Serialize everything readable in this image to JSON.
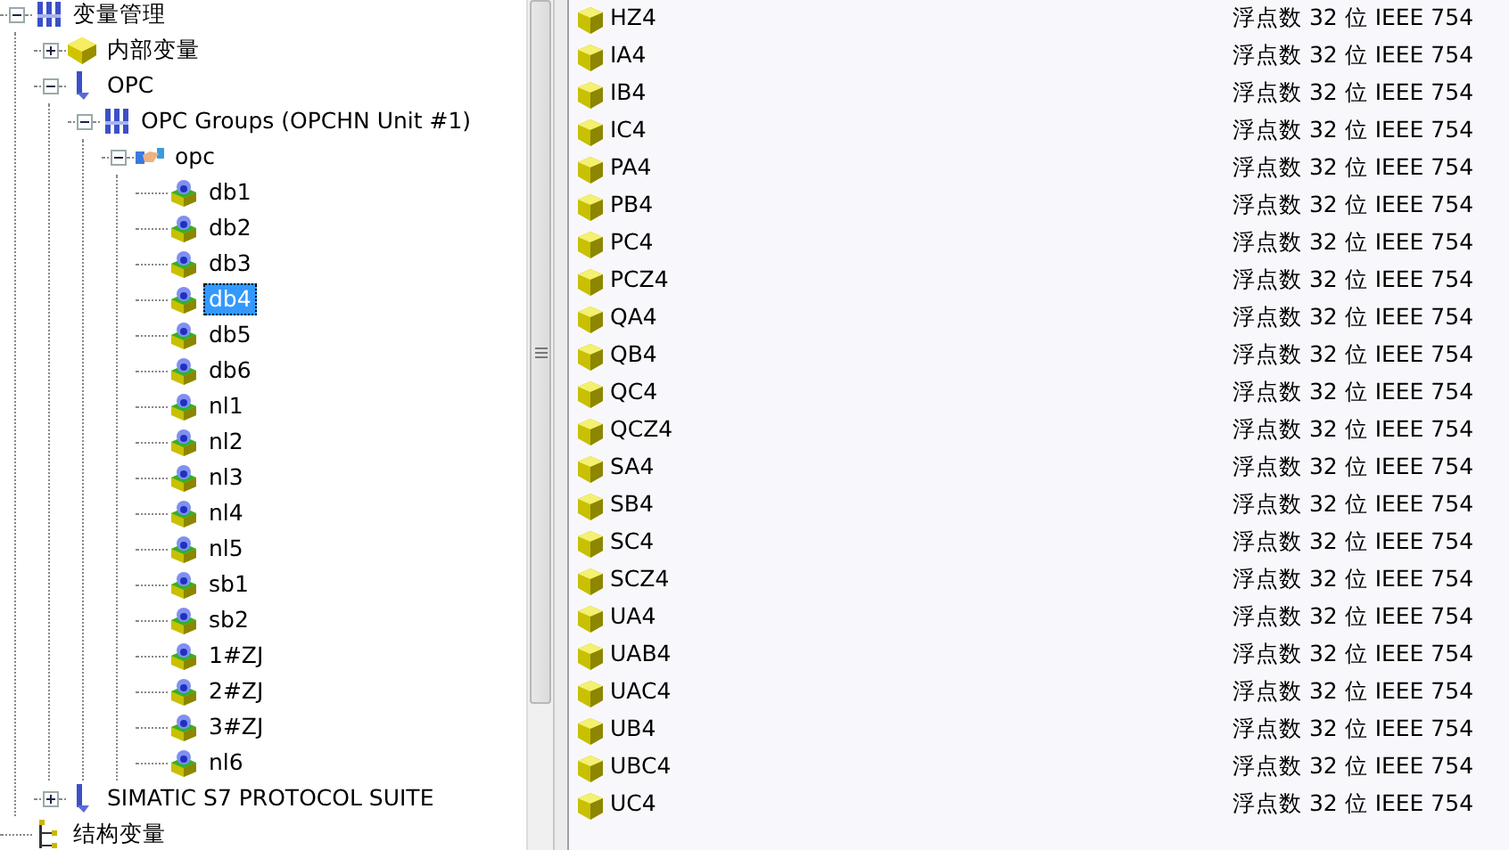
{
  "tree": [
    {
      "label": "变量管理",
      "kind": "group",
      "expanded": true,
      "selected": false,
      "children": [
        {
          "label": "内部变量",
          "kind": "internal",
          "expanded": false,
          "selected": false
        },
        {
          "label": "OPC",
          "kind": "driver",
          "expanded": true,
          "selected": false,
          "children": [
            {
              "label": "OPC Groups (OPCHN Unit #1)",
              "kind": "group",
              "expanded": true,
              "selected": false,
              "children": [
                {
                  "label": "opc",
                  "kind": "connection",
                  "expanded": true,
                  "selected": false,
                  "children": [
                    {
                      "label": "db1",
                      "kind": "tag",
                      "selected": false
                    },
                    {
                      "label": "db2",
                      "kind": "tag",
                      "selected": false
                    },
                    {
                      "label": "db3",
                      "kind": "tag",
                      "selected": false
                    },
                    {
                      "label": "db4",
                      "kind": "tag",
                      "selected": true
                    },
                    {
                      "label": "db5",
                      "kind": "tag",
                      "selected": false
                    },
                    {
                      "label": "db6",
                      "kind": "tag",
                      "selected": false
                    },
                    {
                      "label": "nl1",
                      "kind": "tag",
                      "selected": false
                    },
                    {
                      "label": "nl2",
                      "kind": "tag",
                      "selected": false
                    },
                    {
                      "label": "nl3",
                      "kind": "tag",
                      "selected": false
                    },
                    {
                      "label": "nl4",
                      "kind": "tag",
                      "selected": false
                    },
                    {
                      "label": "nl5",
                      "kind": "tag",
                      "selected": false
                    },
                    {
                      "label": "sb1",
                      "kind": "tag",
                      "selected": false
                    },
                    {
                      "label": "sb2",
                      "kind": "tag",
                      "selected": false
                    },
                    {
                      "label": "1#ZJ",
                      "kind": "tag",
                      "selected": false
                    },
                    {
                      "label": "2#ZJ",
                      "kind": "tag",
                      "selected": false
                    },
                    {
                      "label": "3#ZJ",
                      "kind": "tag",
                      "selected": false
                    },
                    {
                      "label": "nl6",
                      "kind": "tag",
                      "selected": false
                    }
                  ]
                }
              ]
            }
          ]
        },
        {
          "label": "SIMATIC S7 PROTOCOL SUITE",
          "kind": "driver",
          "expanded": false,
          "selected": false
        }
      ]
    },
    {
      "label": "结构变量",
      "kind": "struct",
      "selected": false
    }
  ],
  "variables": [
    {
      "name": "HZ4",
      "type": "浮点数 32 位 IEEE 754"
    },
    {
      "name": "IA4",
      "type": "浮点数 32 位 IEEE 754"
    },
    {
      "name": "IB4",
      "type": "浮点数 32 位 IEEE 754"
    },
    {
      "name": "IC4",
      "type": "浮点数 32 位 IEEE 754"
    },
    {
      "name": "PA4",
      "type": "浮点数 32 位 IEEE 754"
    },
    {
      "name": "PB4",
      "type": "浮点数 32 位 IEEE 754"
    },
    {
      "name": "PC4",
      "type": "浮点数 32 位 IEEE 754"
    },
    {
      "name": "PCZ4",
      "type": "浮点数 32 位 IEEE 754"
    },
    {
      "name": "QA4",
      "type": "浮点数 32 位 IEEE 754"
    },
    {
      "name": "QB4",
      "type": "浮点数 32 位 IEEE 754"
    },
    {
      "name": "QC4",
      "type": "浮点数 32 位 IEEE 754"
    },
    {
      "name": "QCZ4",
      "type": "浮点数 32 位 IEEE 754"
    },
    {
      "name": "SA4",
      "type": "浮点数 32 位 IEEE 754"
    },
    {
      "name": "SB4",
      "type": "浮点数 32 位 IEEE 754"
    },
    {
      "name": "SC4",
      "type": "浮点数 32 位 IEEE 754"
    },
    {
      "name": "SCZ4",
      "type": "浮点数 32 位 IEEE 754"
    },
    {
      "name": "UA4",
      "type": "浮点数 32 位 IEEE 754"
    },
    {
      "name": "UAB4",
      "type": "浮点数 32 位 IEEE 754"
    },
    {
      "name": "UAC4",
      "type": "浮点数 32 位 IEEE 754"
    },
    {
      "name": "UB4",
      "type": "浮点数 32 位 IEEE 754"
    },
    {
      "name": "UBC4",
      "type": "浮点数 32 位 IEEE 754"
    },
    {
      "name": "UC4",
      "type": "浮点数 32 位 IEEE 754"
    }
  ]
}
